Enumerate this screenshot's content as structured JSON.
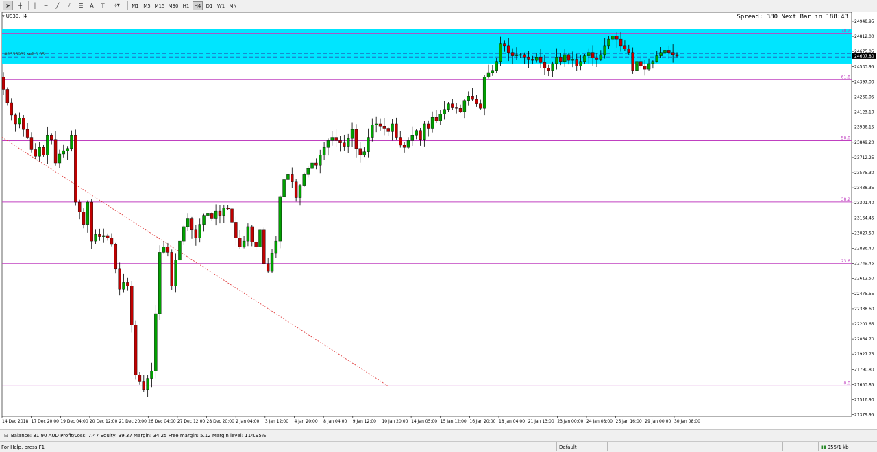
{
  "toolbar": {
    "tools": [
      "cursor-icon",
      "crosshair-icon",
      "vertical-line-icon",
      "horizontal-line-icon",
      "trendline-icon",
      "channel-icon",
      "fibonacci-icon",
      "text-icon",
      "text-label-icon",
      "shapes-icon"
    ],
    "text_tool_label": "A",
    "timeframes": [
      "M1",
      "M5",
      "M15",
      "M30",
      "H1",
      "H4",
      "D1",
      "W1",
      "MN"
    ],
    "selected_timeframe": "H4"
  },
  "chart": {
    "title": "US30,H4",
    "spread_text": "Spread: 380 Next Bar in 188:43",
    "trade_label": "#1555932 sell 0.05",
    "current_price": "24607.80",
    "price_axis": [
      "24948.95",
      "24812.00",
      "24675.05",
      "24533.95",
      "24397.00",
      "24260.05",
      "24123.10",
      "23986.15",
      "23849.20",
      "23712.25",
      "23575.30",
      "23438.35",
      "23301.40",
      "23164.45",
      "23027.50",
      "22886.40",
      "22749.45",
      "22612.50",
      "22475.55",
      "22338.60",
      "22201.65",
      "22064.70",
      "21927.75",
      "21790.80",
      "21653.85",
      "21516.90",
      "21379.95"
    ],
    "time_axis": [
      "14 Dec 2018",
      "17 Dec 20:00",
      "19 Dec 04:00",
      "20 Dec 12:00",
      "21 Dec 20:00",
      "26 Dec 04:00",
      "27 Dec 12:00",
      "28 Dec 20:00",
      "2 Jan 04:00",
      "3 Jan 12:00",
      "4 Jan 20:00",
      "8 Jan 04:00",
      "9 Jan 12:00",
      "10 Jan 20:00",
      "14 Jan 05:00",
      "15 Jan 12:00",
      "16 Jan 20:00",
      "18 Jan 04:00",
      "21 Jan 13:00",
      "23 Jan 00:00",
      "24 Jan 08:00",
      "25 Jan 16:00",
      "29 Jan 00:00",
      "30 Jan 08:00"
    ],
    "fib_levels": [
      {
        "label": "78.2",
        "price": 24812.0
      },
      {
        "label": "61.8",
        "price": 24397.0
      },
      {
        "label": "50.0",
        "price": 23849.2
      },
      {
        "label": "38.2",
        "price": 23301.4
      },
      {
        "label": "23.6",
        "price": 22749.45
      },
      {
        "label": "0.0",
        "price": 21653.85
      }
    ],
    "colors": {
      "bull": "#00a000",
      "bear": "#c00000",
      "zone": "#00e5ff",
      "fib": "#c040c0",
      "trendline": "#e04040",
      "order_line": "#1f6fbf"
    }
  },
  "chart_data": {
    "type": "candlestick",
    "symbol": "US30",
    "timeframe": "H4",
    "ylim": [
      21379.95,
      25000
    ],
    "closes": [
      24310,
      24190,
      24080,
      24000,
      24050,
      23950,
      23880,
      23770,
      23710,
      23790,
      23720,
      23900,
      23860,
      23650,
      23730,
      23760,
      23780,
      23900,
      23300,
      23210,
      23100,
      23300,
      22950,
      23010,
      22990,
      23000,
      22980,
      22920,
      22700,
      22520,
      22580,
      22550,
      22200,
      21750,
      21690,
      21620,
      21720,
      21790,
      22300,
      22850,
      22900,
      22850,
      22550,
      22780,
      22950,
      23080,
      23150,
      23050,
      22980,
      23100,
      23180,
      23200,
      23150,
      23220,
      23180,
      23250,
      23240,
      23120,
      22980,
      22900,
      22950,
      23080,
      22940,
      22900,
      23050,
      22750,
      22680,
      22840,
      22950,
      23350,
      23500,
      23550,
      23480,
      23340,
      23450,
      23550,
      23600,
      23650,
      23630,
      23720,
      23790,
      23850,
      23880,
      23850,
      23830,
      23800,
      23870,
      23950,
      23780,
      23720,
      23750,
      23880,
      23990,
      24000,
      23980,
      23960,
      23930,
      24000,
      23880,
      23810,
      23790,
      23850,
      23900,
      23940,
      23860,
      24000,
      23960,
      24060,
      24030,
      24090,
      24130,
      24180,
      24150,
      24140,
      24110,
      24210,
      24250,
      24220,
      24180,
      24140,
      24420,
      24460,
      24480,
      24560,
      24720,
      24700,
      24640,
      24610,
      24620,
      24620,
      24600,
      24580,
      24570,
      24600,
      24550,
      24500,
      24480,
      24540,
      24600,
      24560,
      24620,
      24570,
      24580,
      24520,
      24560,
      24610,
      24640,
      24590,
      24580,
      24620,
      24700,
      24760,
      24790,
      24760,
      24700,
      24670,
      24640,
      24480,
      24560,
      24520,
      24490,
      24540,
      24560,
      24610,
      24640,
      24660,
      24640,
      24620,
      24607.8
    ]
  },
  "terminal": {
    "text": "Balance: 31.90 AUD  Profit/Loss: 7.47  Equity: 39.37  Margin: 34.25  Free margin: 5.12  Margin level: 114.95%"
  },
  "status": {
    "help": "For Help, press F1",
    "profile": "Default",
    "traffic": "955/1 kb"
  }
}
